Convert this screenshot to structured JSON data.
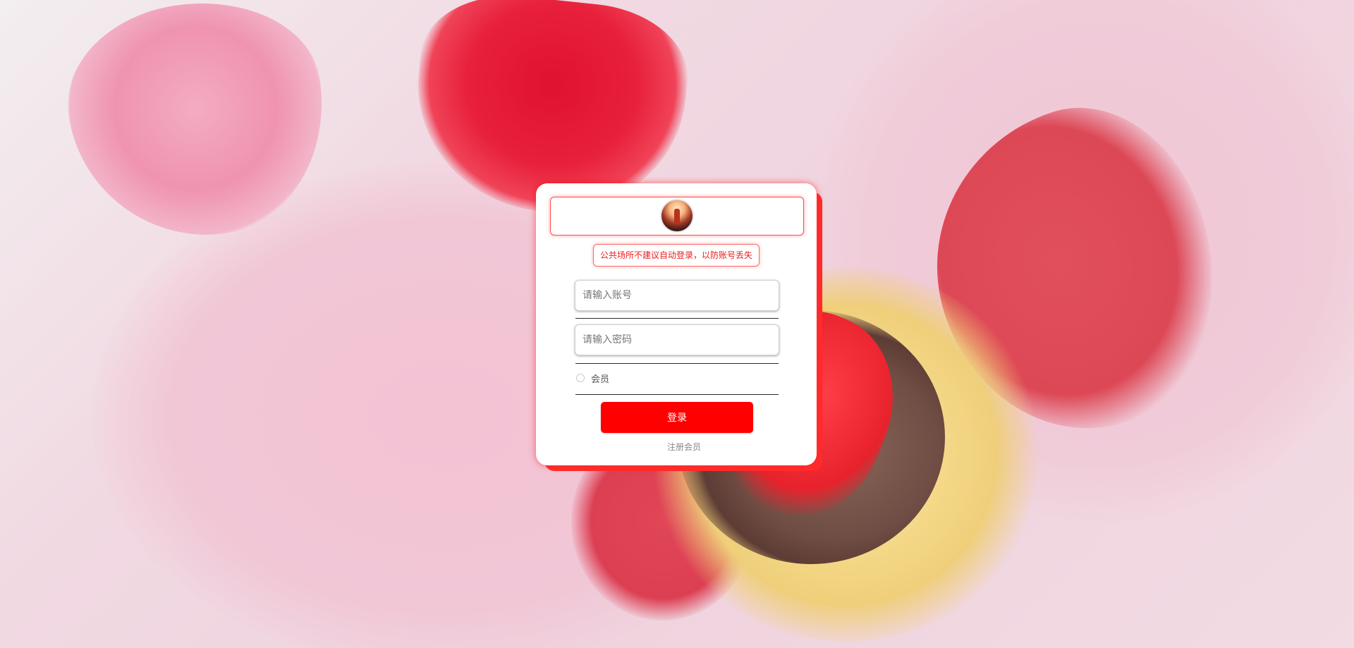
{
  "background": {
    "image_name": "strawberry-cupcake-hearts-photo",
    "accent_color": "#ff0000"
  },
  "login_card": {
    "logo_icon": "avatar-logo",
    "notice": "公共场所不建议自动登录，以防账号丢失",
    "account_input": {
      "placeholder": "请输入账号",
      "value": ""
    },
    "password_input": {
      "placeholder": "请输入密码",
      "value": ""
    },
    "member_option": {
      "label": "会员",
      "checked": false
    },
    "login_button": "登录",
    "register_link": "注册会员"
  }
}
